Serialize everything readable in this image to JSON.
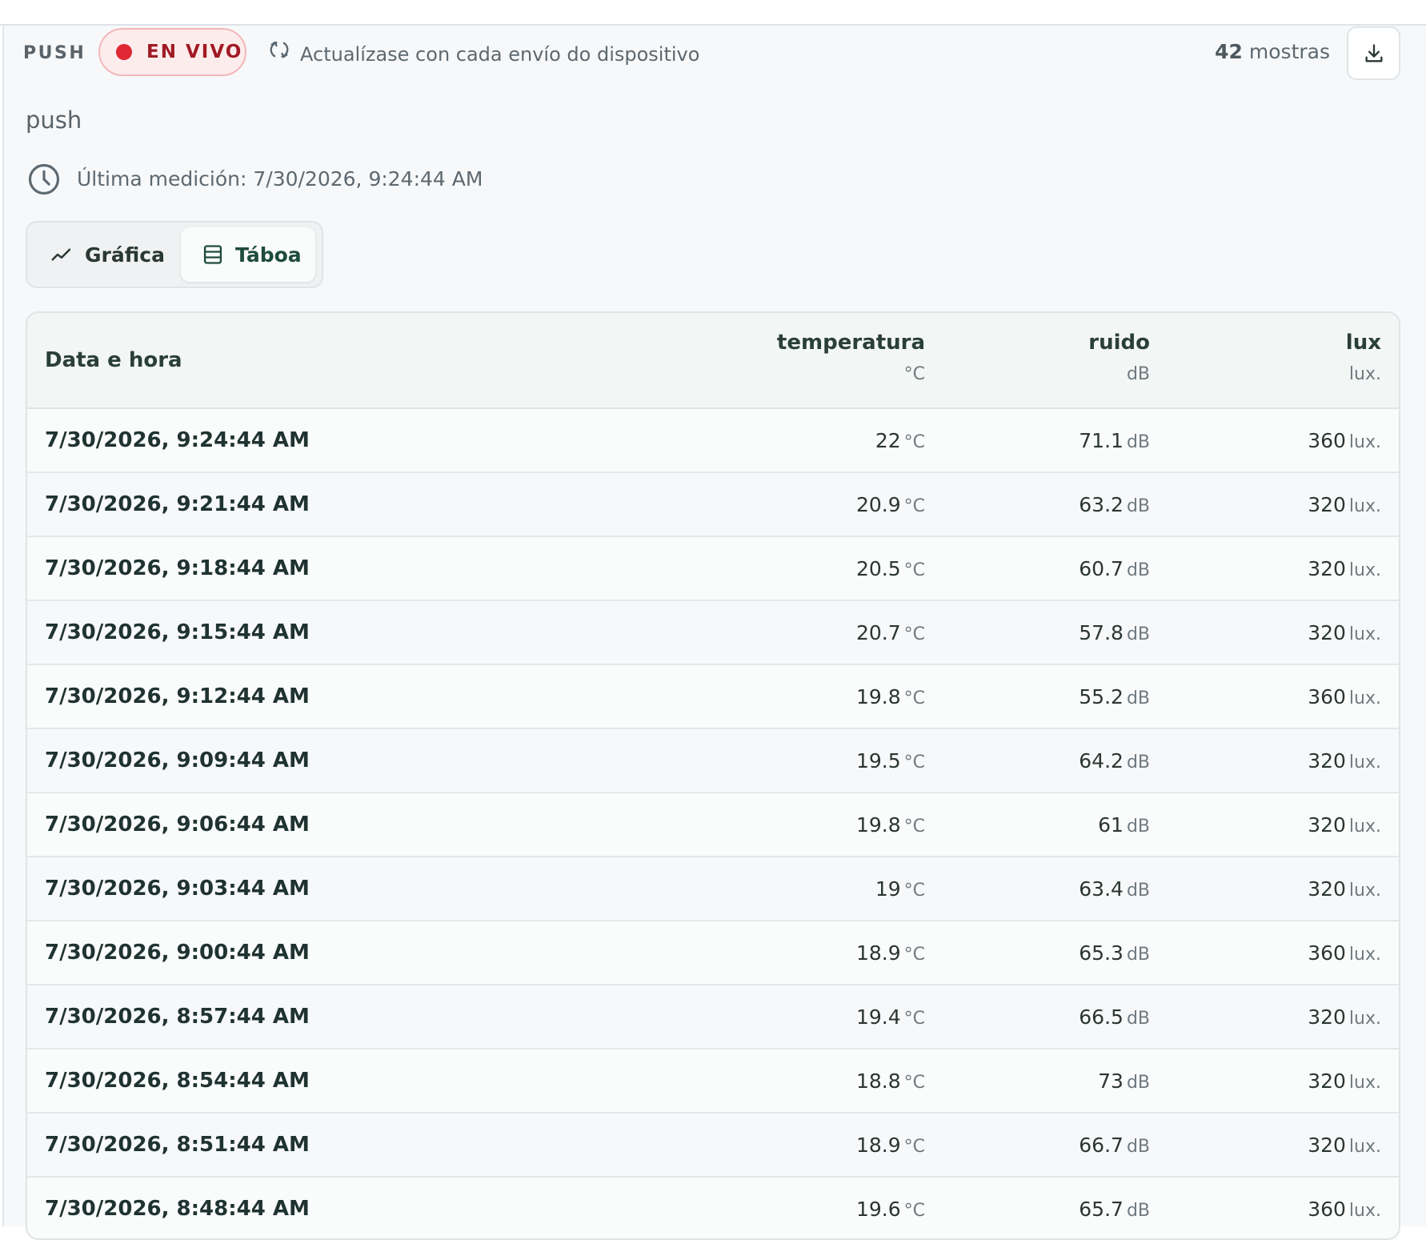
{
  "header": {
    "push_tag": "PUSH",
    "live_label": "EN VIVO",
    "refresh_note": "Actualízase con cada envío do dispositivo",
    "samples_count": "42",
    "samples_label": "mostras",
    "download_icon": "download-icon",
    "refresh_icon": "refresh-icon"
  },
  "source": {
    "name": "push",
    "last_measurement": "Última medición: 7/30/2026, 9:24:44 AM",
    "clock_icon": "clock-icon"
  },
  "tabs": [
    {
      "label": "Gráfica",
      "icon": "line-chart-icon",
      "active": false
    },
    {
      "label": "Táboa",
      "icon": "table-icon",
      "active": true
    }
  ],
  "colors": {
    "live_red": "#e02734",
    "accent_green": "#1e4b3c"
  },
  "table": {
    "time_header": "Data e hora",
    "columns": [
      {
        "name": "temperatura",
        "unit": "°C"
      },
      {
        "name": "ruido",
        "unit": "dB"
      },
      {
        "name": "lux",
        "unit": "lux."
      }
    ],
    "rows": [
      {
        "time": "7/30/2026, 9:24:44 AM",
        "temperatura": "22",
        "ruido": "71.1",
        "lux": "360"
      },
      {
        "time": "7/30/2026, 9:21:44 AM",
        "temperatura": "20.9",
        "ruido": "63.2",
        "lux": "320"
      },
      {
        "time": "7/30/2026, 9:18:44 AM",
        "temperatura": "20.5",
        "ruido": "60.7",
        "lux": "320"
      },
      {
        "time": "7/30/2026, 9:15:44 AM",
        "temperatura": "20.7",
        "ruido": "57.8",
        "lux": "320"
      },
      {
        "time": "7/30/2026, 9:12:44 AM",
        "temperatura": "19.8",
        "ruido": "55.2",
        "lux": "360"
      },
      {
        "time": "7/30/2026, 9:09:44 AM",
        "temperatura": "19.5",
        "ruido": "64.2",
        "lux": "320"
      },
      {
        "time": "7/30/2026, 9:06:44 AM",
        "temperatura": "19.8",
        "ruido": "61",
        "lux": "320"
      },
      {
        "time": "7/30/2026, 9:03:44 AM",
        "temperatura": "19",
        "ruido": "63.4",
        "lux": "320"
      },
      {
        "time": "7/30/2026, 9:00:44 AM",
        "temperatura": "18.9",
        "ruido": "65.3",
        "lux": "360"
      },
      {
        "time": "7/30/2026, 8:57:44 AM",
        "temperatura": "19.4",
        "ruido": "66.5",
        "lux": "320"
      },
      {
        "time": "7/30/2026, 8:54:44 AM",
        "temperatura": "18.8",
        "ruido": "73",
        "lux": "320"
      },
      {
        "time": "7/30/2026, 8:51:44 AM",
        "temperatura": "18.9",
        "ruido": "66.7",
        "lux": "320"
      },
      {
        "time": "7/30/2026, 8:48:44 AM",
        "temperatura": "19.6",
        "ruido": "65.7",
        "lux": "360"
      }
    ]
  }
}
